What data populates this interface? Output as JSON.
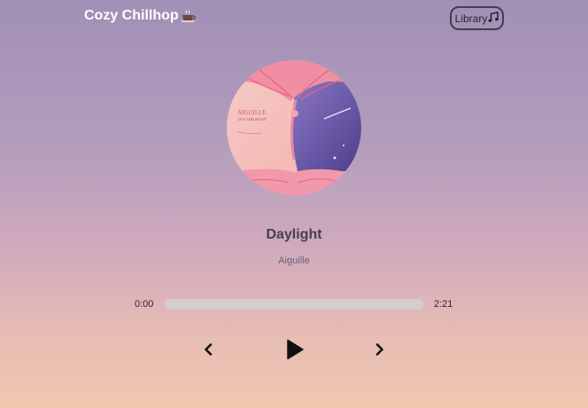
{
  "nav": {
    "title": "Cozy Chillhop",
    "title_icon": "coffee-cup-icon",
    "library_label": "Library",
    "library_icon": "music-note-icon"
  },
  "track": {
    "title": "Daylight",
    "artist": "Aiguille",
    "cover_text": "AIGUILLE",
    "cover_subtext": "DAY AND NIGHT"
  },
  "player": {
    "current_time": "0:00",
    "duration": "2:21",
    "progress": 0,
    "prev_icon": "chevron-left-icon",
    "play_icon": "play-icon",
    "next_icon": "chevron-right-icon"
  },
  "colors": {
    "background_top": "#a18fb6",
    "background_bottom": "#f0c8ae",
    "track_bar": "#d6cdd1"
  }
}
